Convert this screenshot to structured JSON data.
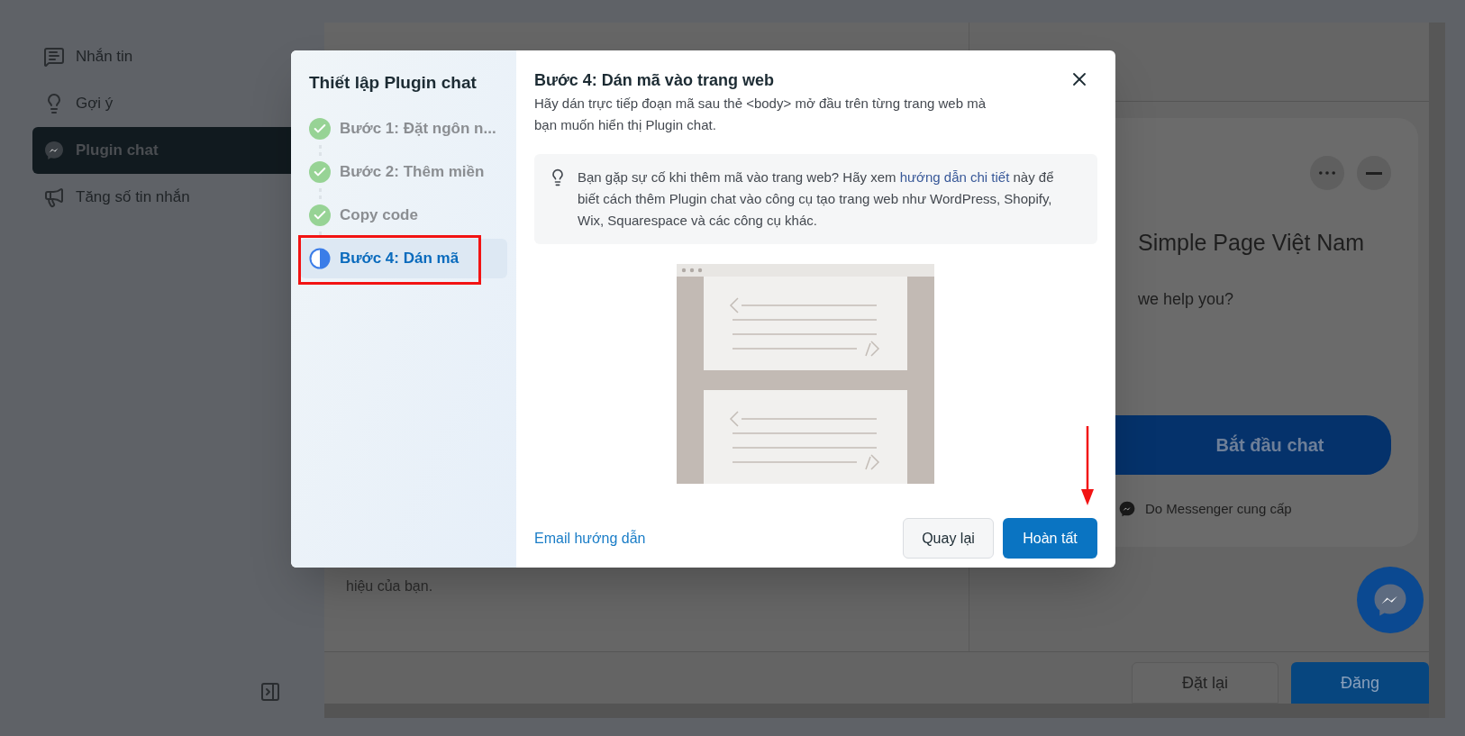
{
  "sidebar": {
    "items": [
      {
        "label": "Nhắn tin",
        "selected": false
      },
      {
        "label": "Gợi ý",
        "selected": false
      },
      {
        "label": "Plugin chat",
        "selected": true
      },
      {
        "label": "Tăng số tin nhắn",
        "selected": false
      }
    ]
  },
  "main_panel": {
    "text": "hiệu của bạn."
  },
  "preview": {
    "page_name": "Simple Page Việt Nam",
    "greeting": "we help you?",
    "start_button": "Bắt đầu chat",
    "footer": "Do Messenger cung cấp"
  },
  "bottom_bar": {
    "buttons": [
      {
        "label": "Đặt lại",
        "kind": "secondary"
      },
      {
        "label": "Đăng",
        "kind": "primary"
      }
    ]
  },
  "modal": {
    "sidebar_title": "Thiết lập Plugin chat",
    "steps": [
      {
        "label": "Bước 1: Đặt ngôn n...",
        "completed": true,
        "selected": false
      },
      {
        "label": "Bước 2: Thêm miền",
        "completed": true,
        "selected": false
      },
      {
        "label": "Copy code",
        "completed": true,
        "selected": false
      },
      {
        "label": "Bước 4: Dán mã",
        "completed": false,
        "selected": true
      }
    ],
    "title": "Bước 4: Dán mã vào trang web",
    "description": "Hãy dán trực tiếp đoạn mã sau thẻ <body> mở đầu trên từng trang web mà bạn muốn hiển thị Plugin chat.",
    "tip": {
      "before": "Bạn gặp sự cố khi thêm mã vào trang web? Hãy xem ",
      "link": "hướng dẫn chi tiết",
      "after": " này để biết cách thêm Plugin chat vào công cụ tạo trang web như WordPress, Shopify, Wix, Squarespace và các công cụ khác."
    },
    "email_link": "Email hướng dẫn",
    "buttons": [
      {
        "label": "Quay lại",
        "kind": "secondary"
      },
      {
        "label": "Hoàn tất",
        "kind": "primary"
      }
    ]
  }
}
